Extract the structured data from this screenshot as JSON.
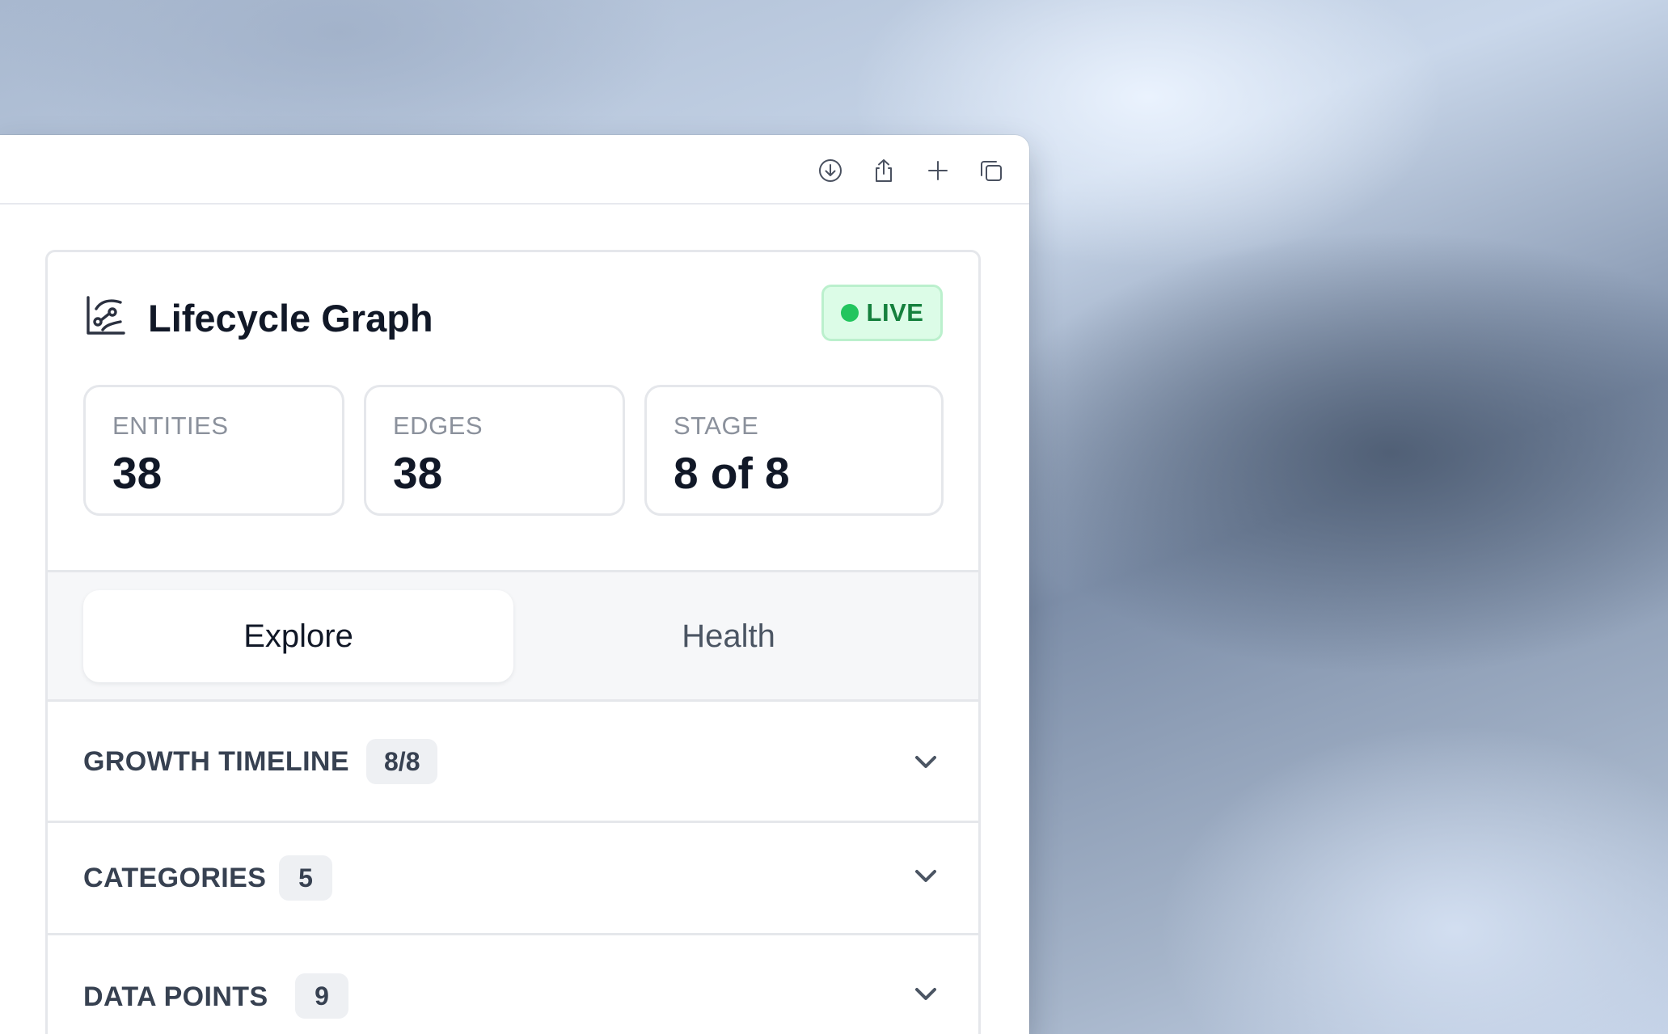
{
  "toolbar": {
    "icons": [
      "download-icon",
      "share-icon",
      "plus-icon",
      "copy-icon"
    ]
  },
  "card": {
    "title": "Lifecycle Graph",
    "title_icon": "graph-chart-icon",
    "status_badge": "LIVE",
    "status_color": "#22c55e",
    "stats": [
      {
        "label": "ENTITIES",
        "value": "38"
      },
      {
        "label": "EDGES",
        "value": "38"
      },
      {
        "label": "STAGE",
        "value": "8 of 8"
      }
    ],
    "tabs": [
      {
        "label": "Explore",
        "active": true
      },
      {
        "label": "Health",
        "active": false
      }
    ],
    "sections": [
      {
        "title": "GROWTH TIMELINE",
        "badge": "8/8"
      },
      {
        "title": "CATEGORIES",
        "badge": "5"
      },
      {
        "title": "DATA POINTS",
        "badge": "9"
      }
    ]
  }
}
